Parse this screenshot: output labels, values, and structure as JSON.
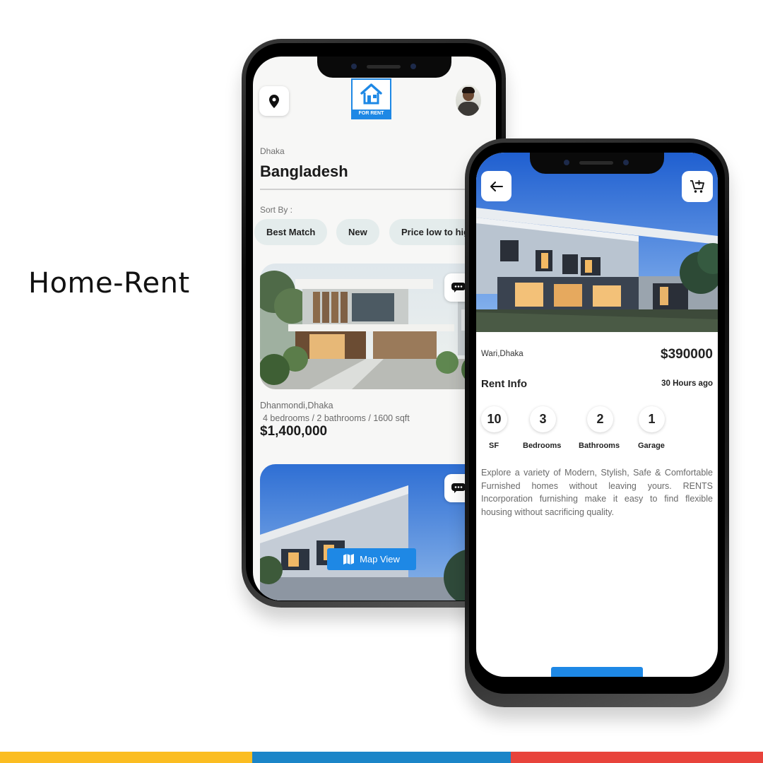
{
  "promo": {
    "title": "Home-Rent"
  },
  "list_screen": {
    "logo_label": "FOR RENT",
    "city": "Dhaka",
    "country": "Bangladesh",
    "sort_label": "Sort By :",
    "sort_chips": [
      "Best Match",
      "New",
      "Price low to high"
    ],
    "listing": {
      "location": "Dhanmondi,Dhaka",
      "specs": "4 bedrooms / 2 bathrooms / 1600 sqft",
      "price": "$1,400,000"
    },
    "map_button_label": "Map View"
  },
  "detail_screen": {
    "location": "Wari,Dhaka",
    "price": "$390000",
    "section_title": "Rent Info",
    "posted": "30 Hours ago",
    "stats": [
      {
        "value": "10",
        "label": "SF"
      },
      {
        "value": "3",
        "label": "Bedrooms"
      },
      {
        "value": "2",
        "label": "Bathrooms"
      },
      {
        "value": "1",
        "label": "Garage"
      }
    ],
    "description": "Explore a variety of Modern, Stylish, Safe & Comfortable Furnished homes without leaving yours. RENTS Incorporation furnishing make it easy to find flexible housing without sacrificing quality."
  },
  "colors": {
    "accent": "#1e88e5",
    "chip_bg": "#e4ecec",
    "bar_yellow": "#fbbd21",
    "bar_blue": "#1b85c8",
    "bar_red": "#e8433b"
  },
  "icons": [
    "map-pin-icon",
    "house-logo-icon",
    "chat-icon",
    "map-icon",
    "back-arrow-icon",
    "cart-add-icon"
  ]
}
